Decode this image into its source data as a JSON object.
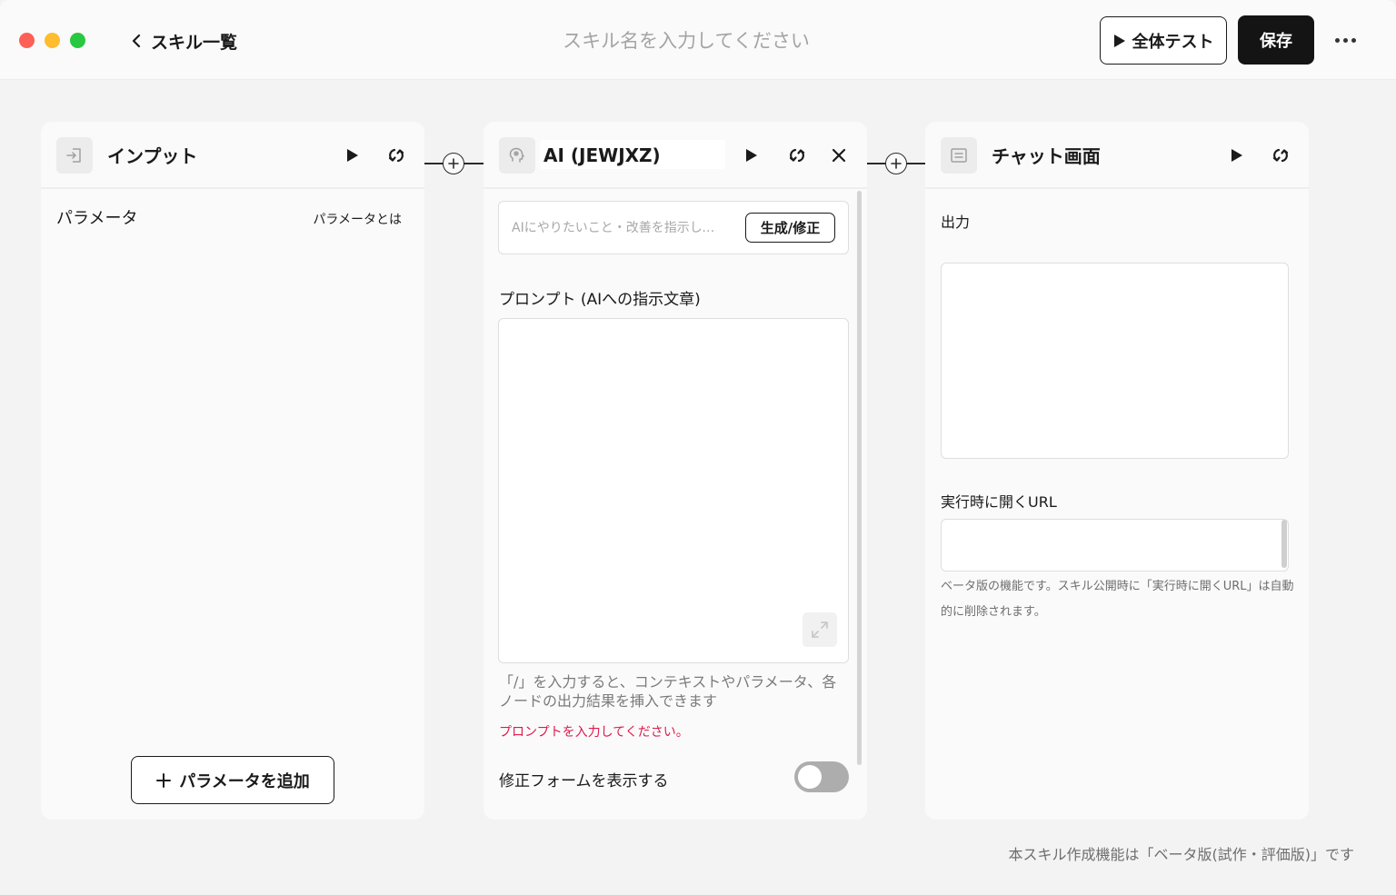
{
  "header": {
    "back_label": "スキル一覧",
    "title_placeholder": "スキル名を入力してください",
    "test_all_label": "全体テスト",
    "save_label": "保存"
  },
  "nodes": {
    "input": {
      "title": "インプット",
      "param_label": "パラメータ",
      "param_help_link": "パラメータとは",
      "add_param_label": "パラメータを追加"
    },
    "ai": {
      "title": "AI (JEWJXZ)",
      "instruct_placeholder": "AIにやりたいこと・改善を指示してください",
      "generate_label": "生成/修正",
      "prompt_label": "プロンプト (AIへの指示文章)",
      "prompt_hint": "「/」を入力すると、コンテキストやパラメータ、各ノードの出力結果を挿入できます",
      "prompt_error": "プロンプトを入力してください。",
      "toggle_label": "修正フォームを表示する",
      "toggle_on": false
    },
    "chat": {
      "title": "チャット画面",
      "output_label": "出力",
      "url_label": "実行時に開くURL",
      "beta_note": "ベータ版の機能です。スキル公開時に「実行時に開くURL」は自動的に削除されます。"
    }
  },
  "footer": {
    "beta_text": "本スキル作成機能は「ベータ版(試作・評価版)」です"
  },
  "colors": {
    "accent_dark": "#141414",
    "error": "#e0194a",
    "toggle_off": "#adadad"
  }
}
